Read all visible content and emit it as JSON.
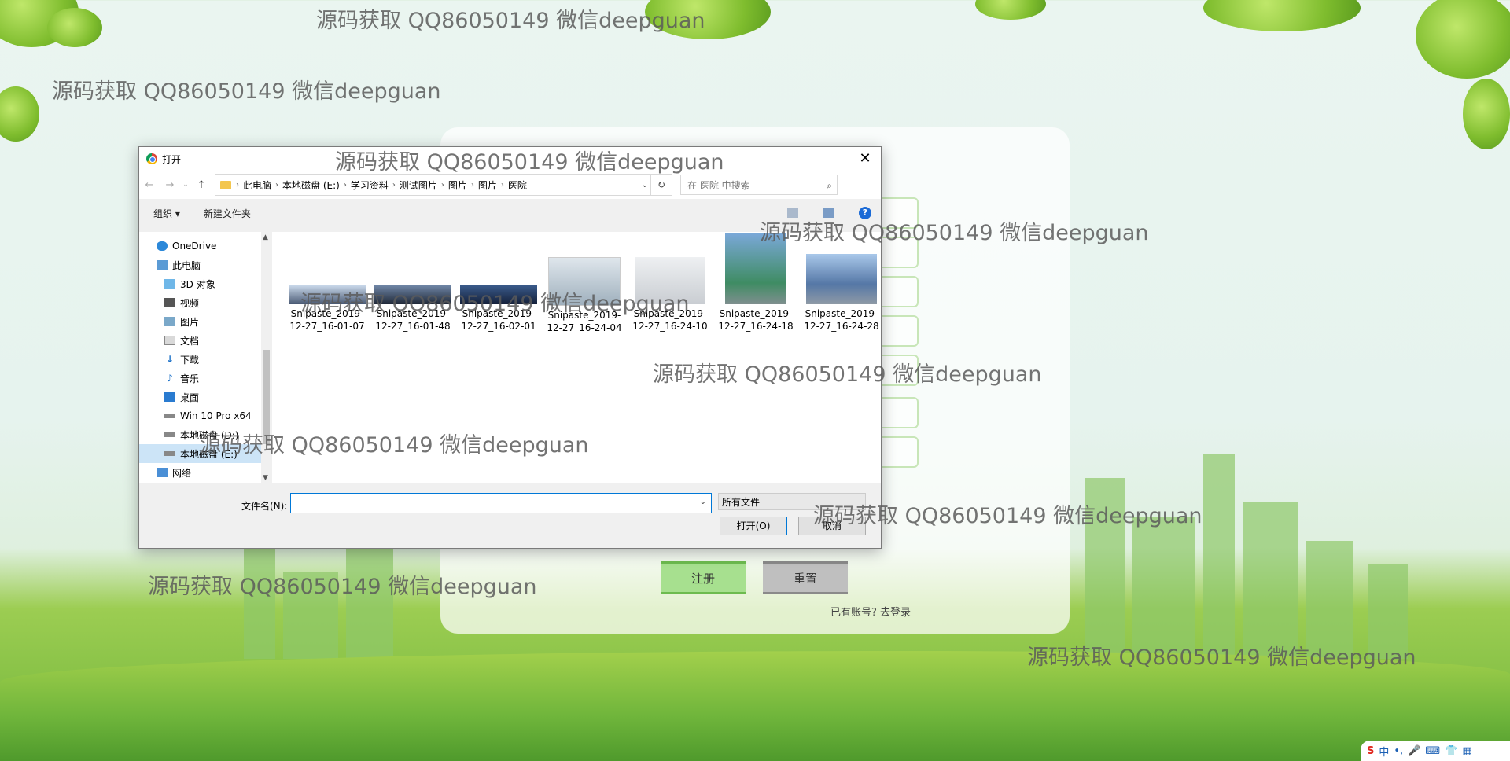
{
  "register_form": {
    "register_label": "注册",
    "reset_label": "重置",
    "login_prompt": "已有账号?",
    "login_link": "去登录"
  },
  "dialog": {
    "title": "打开",
    "breadcrumb": [
      "此电脑",
      "本地磁盘 (E:)",
      "学习资料",
      "测试图片",
      "图片",
      "图片",
      "医院"
    ],
    "search_placeholder": "在 医院 中搜索",
    "toolbar": {
      "organize": "组织 ▾",
      "new_folder": "新建文件夹"
    },
    "nav_items": [
      {
        "label": "OneDrive",
        "icon": "cloud-icon"
      },
      {
        "label": "此电脑",
        "icon": "computer-icon"
      },
      {
        "label": "3D 对象",
        "icon": "cube-icon"
      },
      {
        "label": "视频",
        "icon": "video-icon"
      },
      {
        "label": "图片",
        "icon": "picture-icon"
      },
      {
        "label": "文档",
        "icon": "document-icon"
      },
      {
        "label": "下载",
        "icon": "download-icon"
      },
      {
        "label": "音乐",
        "icon": "music-icon"
      },
      {
        "label": "桌面",
        "icon": "desktop-icon"
      },
      {
        "label": "Win 10 Pro x64",
        "icon": "drive-icon"
      },
      {
        "label": "本地磁盘 (D:)",
        "icon": "drive-icon"
      },
      {
        "label": "本地磁盘 (E:)",
        "icon": "drive-icon"
      },
      {
        "label": "网络",
        "icon": "network-icon"
      }
    ],
    "files": [
      {
        "line1": "Snipaste_2019-",
        "line2": "12-27_16-01-07"
      },
      {
        "line1": "Snipaste_2019-",
        "line2": "12-27_16-01-48"
      },
      {
        "line1": "Snipaste_2019-",
        "line2": "12-27_16-02-01"
      },
      {
        "line1": "Snipaste_2019-",
        "line2": "12-27_16-24-04"
      },
      {
        "line1": "Snipaste_2019-",
        "line2": "12-27_16-24-10"
      },
      {
        "line1": "Snipaste_2019-",
        "line2": "12-27_16-24-18"
      },
      {
        "line1": "Snipaste_2019-",
        "line2": "12-27_16-24-28"
      }
    ],
    "filename_label": "文件名(N):",
    "filename_value": "",
    "filetype": "所有文件",
    "open_label": "打开(O)",
    "cancel_label": "取消"
  },
  "watermark": "源码获取 QQ86050149 微信deepguan",
  "tray": {
    "ime": "中",
    "items": [
      "•,",
      "🎤",
      "⌨",
      "👕",
      "▦"
    ]
  }
}
